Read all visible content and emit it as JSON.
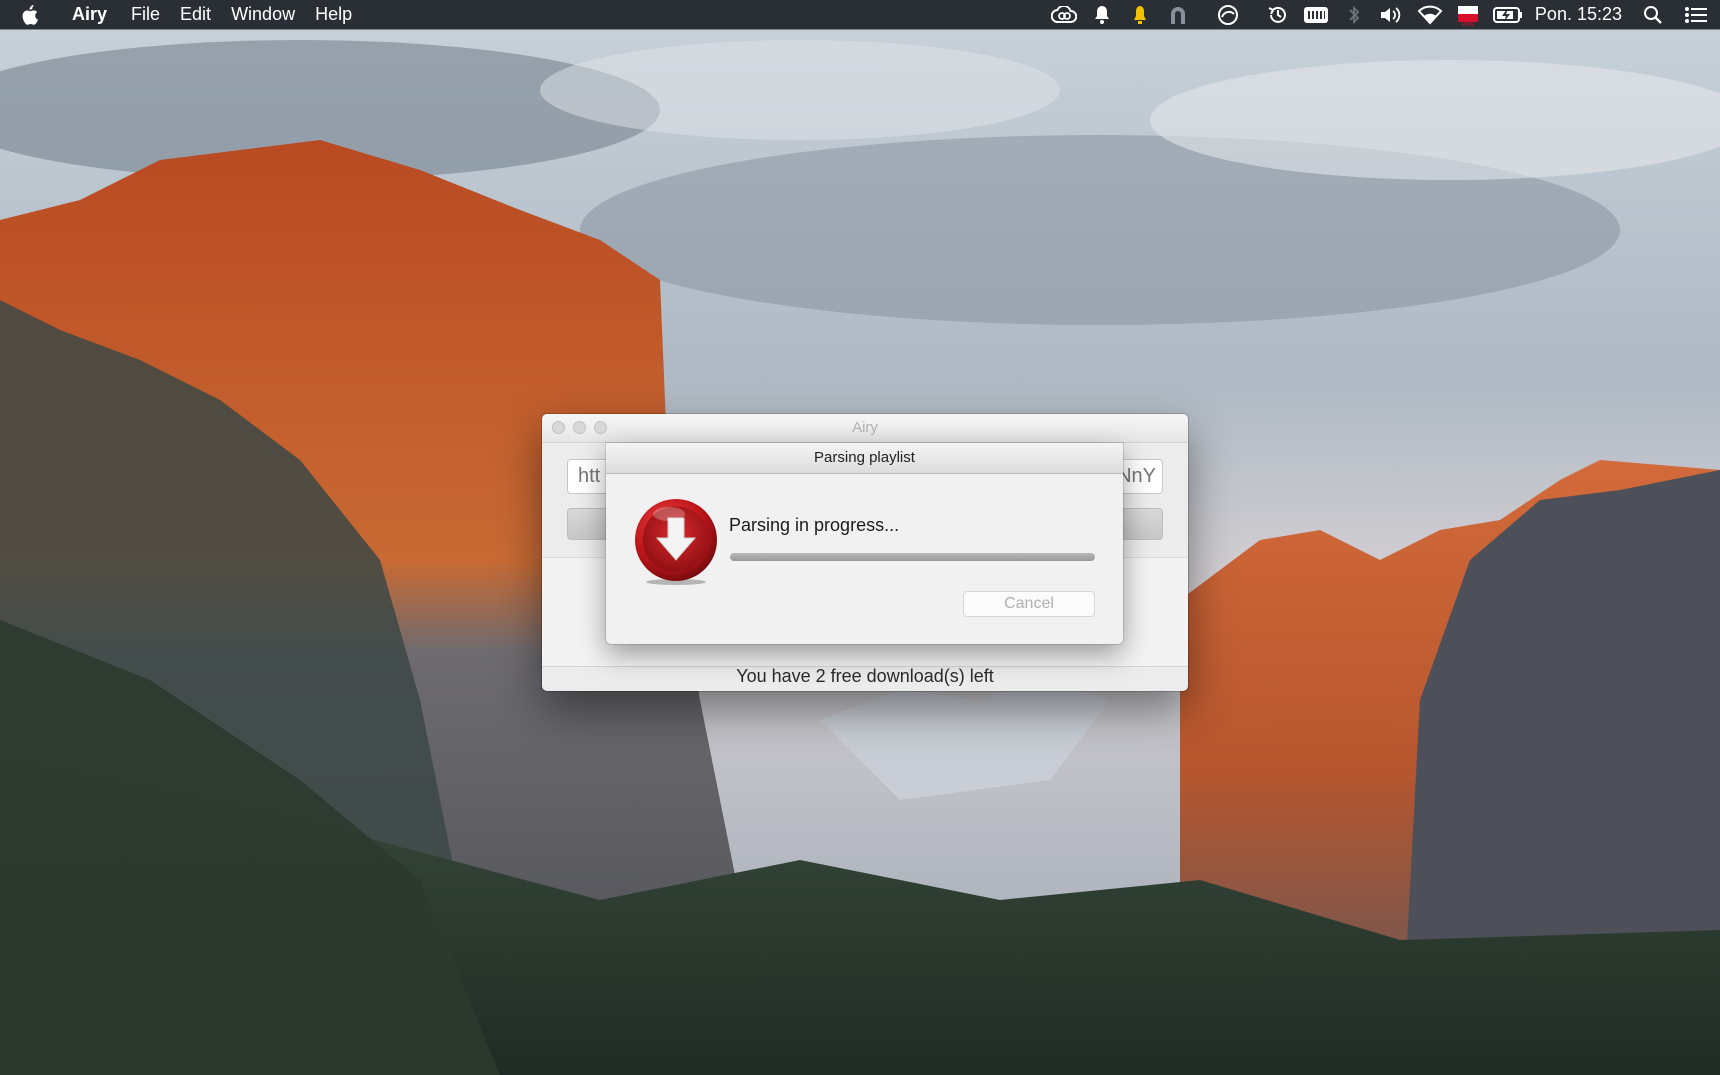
{
  "menubar": {
    "app_name": "Airy",
    "items": [
      "File",
      "Edit",
      "Window",
      "Help"
    ],
    "clock": "Pon. 15:23",
    "status_icons": [
      "creative-cloud-icon",
      "bell-icon",
      "alert-bell-icon",
      "arch-icon",
      "sync-icon",
      "time-machine-icon",
      "keyboard-icon",
      "bluetooth-icon",
      "volume-icon",
      "wifi-icon",
      "flag-pro-icon",
      "battery-charging-icon",
      "search-icon",
      "notification-list-icon"
    ]
  },
  "window": {
    "title": "Airy",
    "url_prefix": "htt",
    "url_suffix": "NnY",
    "footer": "You have 2 free download(s) left"
  },
  "sheet": {
    "title": "Parsing playlist",
    "message": "Parsing in progress...",
    "progress": 1.0,
    "cancel_label": "Cancel"
  },
  "colors": {
    "menubar_bg": "#2a2e35",
    "icon_red": "#c0161b"
  }
}
